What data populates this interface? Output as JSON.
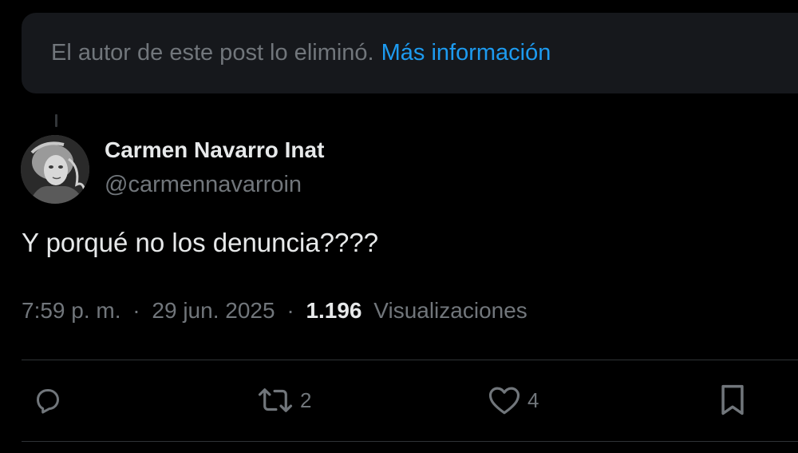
{
  "deleted_notice": {
    "text": "El autor de este post lo eliminó.",
    "link_label": "Más información"
  },
  "author": {
    "name": "Carmen Navarro Inat",
    "handle": "@carmennavarroin"
  },
  "post": {
    "text": "Y porqué no los denuncia????"
  },
  "meta": {
    "time": "7:59 p. m.",
    "separator": "·",
    "date": "29 jun. 2025",
    "views_count": "1.196",
    "views_label": "Visualizaciones"
  },
  "actions": {
    "reply_icon": "reply-icon",
    "retweet_icon": "retweet-icon",
    "retweet_count": "2",
    "like_icon": "heart-icon",
    "like_count": "4",
    "bookmark_icon": "bookmark-icon"
  },
  "colors": {
    "background": "#000000",
    "notice_bg": "#16181c",
    "link": "#1d9bf0",
    "primary_text": "#e7e9ea",
    "secondary_text": "#71767b",
    "divider": "#2f3336"
  }
}
